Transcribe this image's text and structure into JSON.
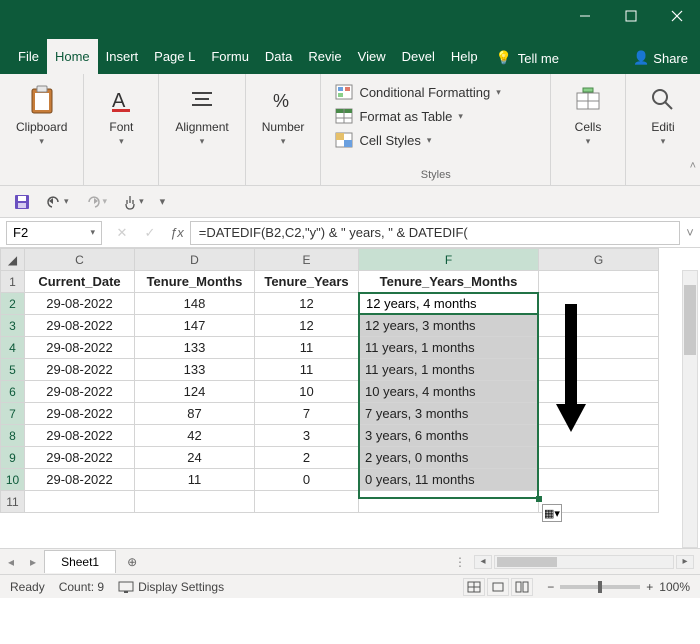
{
  "tabs": [
    "File",
    "Home",
    "Insert",
    "Page L",
    "Formu",
    "Data",
    "Revie",
    "View",
    "Devel",
    "Help"
  ],
  "tellme": "Tell me",
  "share": "Share",
  "ribbon": {
    "clipboard": "Clipboard",
    "font": "Font",
    "alignment": "Alignment",
    "number": "Number",
    "styles": "Styles",
    "cells": "Cells",
    "editing": "Editi",
    "cond_fmt": "Conditional Formatting",
    "fmt_table": "Format as Table",
    "cell_styles": "Cell Styles"
  },
  "namebox": "F2",
  "formula": "=DATEDIF(B2,C2,\"y\") & \" years, \" & DATEDIF(",
  "columns": [
    "C",
    "D",
    "E",
    "F",
    "G"
  ],
  "rows": [
    "1",
    "2",
    "3",
    "4",
    "5",
    "6",
    "7",
    "8",
    "9",
    "10",
    "11"
  ],
  "headers": {
    "c": "Current_Date",
    "d": "Tenure_Months",
    "e": "Tenure_Years",
    "f": "Tenure_Years_Months"
  },
  "data": [
    {
      "c": "29-08-2022",
      "d": "148",
      "e": "12",
      "f": "12 years, 4 months"
    },
    {
      "c": "29-08-2022",
      "d": "147",
      "e": "12",
      "f": "12 years, 3 months"
    },
    {
      "c": "29-08-2022",
      "d": "133",
      "e": "11",
      "f": "11 years, 1 months"
    },
    {
      "c": "29-08-2022",
      "d": "133",
      "e": "11",
      "f": "11 years, 1 months"
    },
    {
      "c": "29-08-2022",
      "d": "124",
      "e": "10",
      "f": "10 years, 4 months"
    },
    {
      "c": "29-08-2022",
      "d": "87",
      "e": "7",
      "f": "7 years, 3 months"
    },
    {
      "c": "29-08-2022",
      "d": "42",
      "e": "3",
      "f": "3 years, 6 months"
    },
    {
      "c": "29-08-2022",
      "d": "24",
      "e": "2",
      "f": "2 years, 0 months"
    },
    {
      "c": "29-08-2022",
      "d": "11",
      "e": "0",
      "f": "0 years, 11 months"
    }
  ],
  "sheet_tab": "Sheet1",
  "status": {
    "ready": "Ready",
    "count": "Count: 9",
    "display": "Display Settings",
    "zoom": "100%"
  }
}
